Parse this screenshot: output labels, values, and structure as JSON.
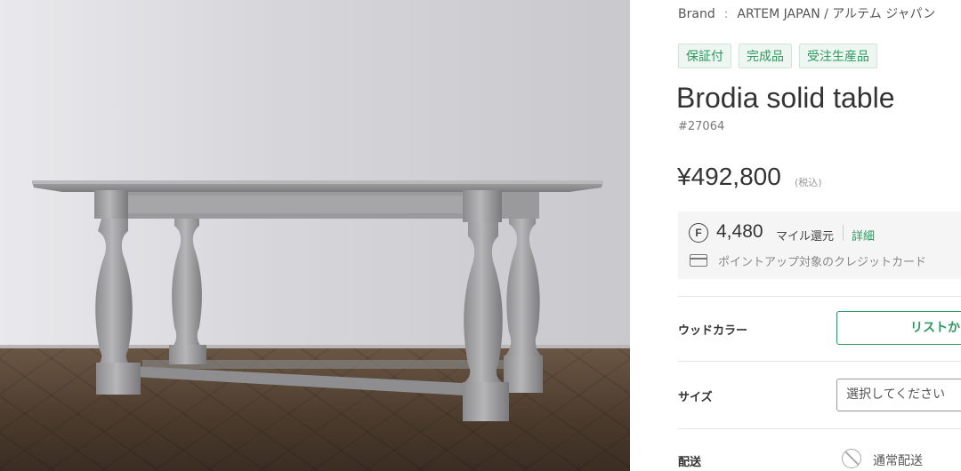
{
  "product_image": {
    "icon": "table-photo"
  },
  "brand": {
    "label": "Brand",
    "separator": ":",
    "name": "ARTEM JAPAN / アルテム ジャパン"
  },
  "tags": [
    "保証付",
    "完成品",
    "受注生産品"
  ],
  "product": {
    "title": "Brodia solid table",
    "sku": "#27064"
  },
  "price": {
    "value": "¥492,800",
    "tax_note": "(税込)"
  },
  "miles": {
    "icon": "F",
    "amount": "4,480",
    "label": "マイル還元",
    "detail_link": "詳細",
    "card_text": "ポイントアップ対象のクレジットカード"
  },
  "options": {
    "wood_color": {
      "label": "ウッドカラー",
      "button": "リストから選択"
    },
    "size": {
      "label": "サイズ",
      "placeholder": "選択してください"
    },
    "shipping": {
      "label": "配送",
      "value": "通常配送"
    }
  },
  "colors": {
    "accent": "#2a9a5f",
    "tag_bg": "#eef6f1"
  }
}
